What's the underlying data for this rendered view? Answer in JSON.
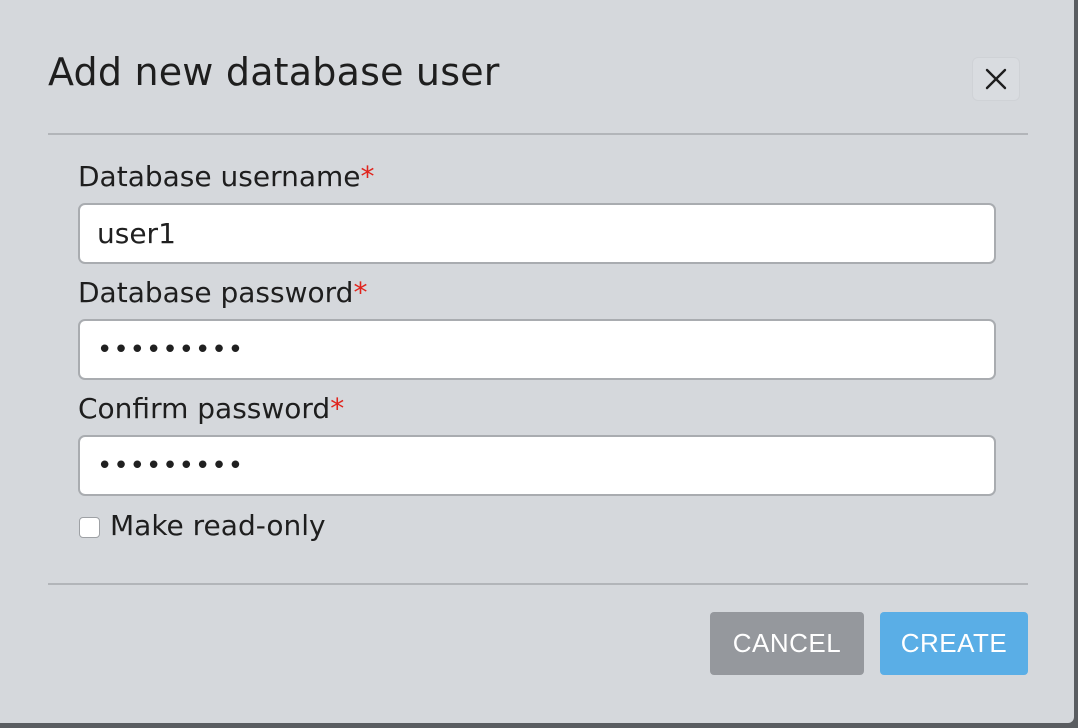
{
  "dialog": {
    "title": "Add new database user",
    "close_icon": "close-icon"
  },
  "form": {
    "username": {
      "label": "Database username",
      "required_marker": "*",
      "value": "user1"
    },
    "password": {
      "label": "Database password",
      "required_marker": "*",
      "value": "•••••••••"
    },
    "confirm_password": {
      "label": "Confirm password",
      "required_marker": "*",
      "value": "•••••••••"
    },
    "read_only": {
      "label": "Make read-only",
      "checked": false
    }
  },
  "footer": {
    "cancel_label": "CANCEL",
    "create_label": "CREATE"
  },
  "colors": {
    "dialog_background": "#d5d8dc",
    "required": "#e0231c",
    "cancel_button": "#95989d",
    "create_button": "#5aaee6"
  }
}
